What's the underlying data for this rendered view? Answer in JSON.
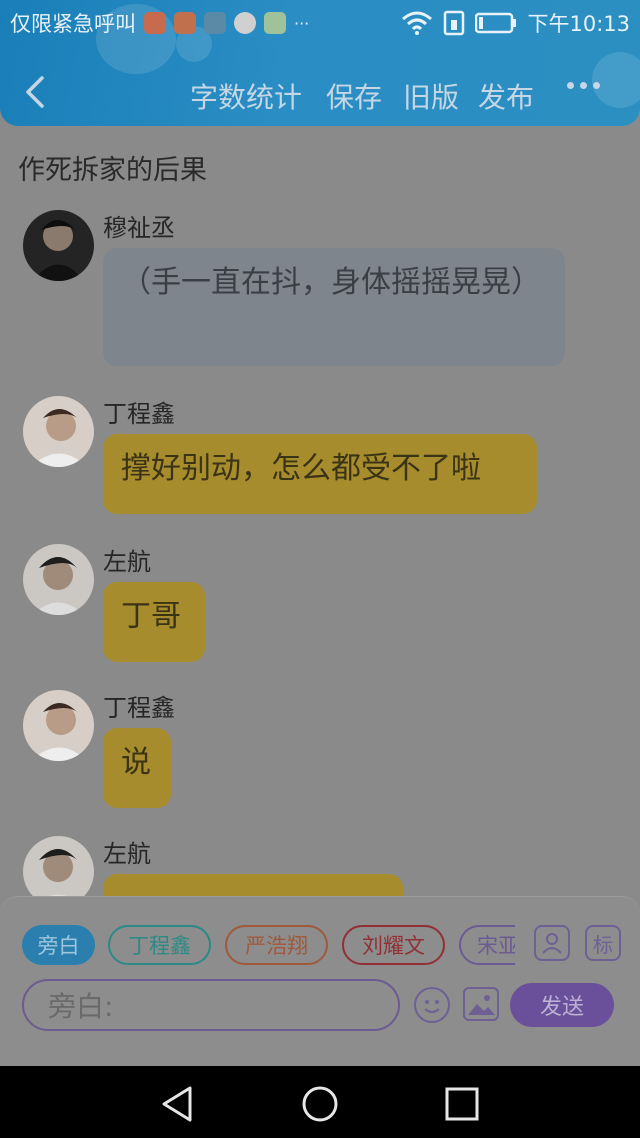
{
  "status": {
    "notice": "仅限紧急呼叫",
    "more_dots": "···",
    "time": "下午10:13"
  },
  "toolbar": {
    "word_count": "字数统计",
    "save": "保存",
    "old_version": "旧版",
    "publish": "发布"
  },
  "story_title": "作死拆家的后果",
  "messages": [
    {
      "name": "穆祉丞",
      "text": "（手一直在抖，身体摇摇晃晃）",
      "style": "grey"
    },
    {
      "name": "丁程鑫",
      "text": "撑好别动，怎么都受不了啦",
      "style": "gold"
    },
    {
      "name": "左航",
      "text": "丁哥",
      "style": "gold"
    },
    {
      "name": "丁程鑫",
      "text": "说",
      "style": "gold"
    },
    {
      "name": "左航",
      "text": "",
      "style": "gold"
    }
  ],
  "role_chips": [
    {
      "label": "旁白",
      "selected": true,
      "color": "#2a7fae"
    },
    {
      "label": "丁程鑫",
      "selected": false,
      "color": "#2c8a86"
    },
    {
      "label": "严浩翔",
      "selected": false,
      "color": "#a0593a"
    },
    {
      "label": "刘耀文",
      "selected": false,
      "color": "#922f35"
    },
    {
      "label": "宋亚轩",
      "selected": false,
      "color": "#6c5a93"
    }
  ],
  "tag_button": "标",
  "input": {
    "placeholder": "旁白:"
  },
  "send_button": "发送"
}
